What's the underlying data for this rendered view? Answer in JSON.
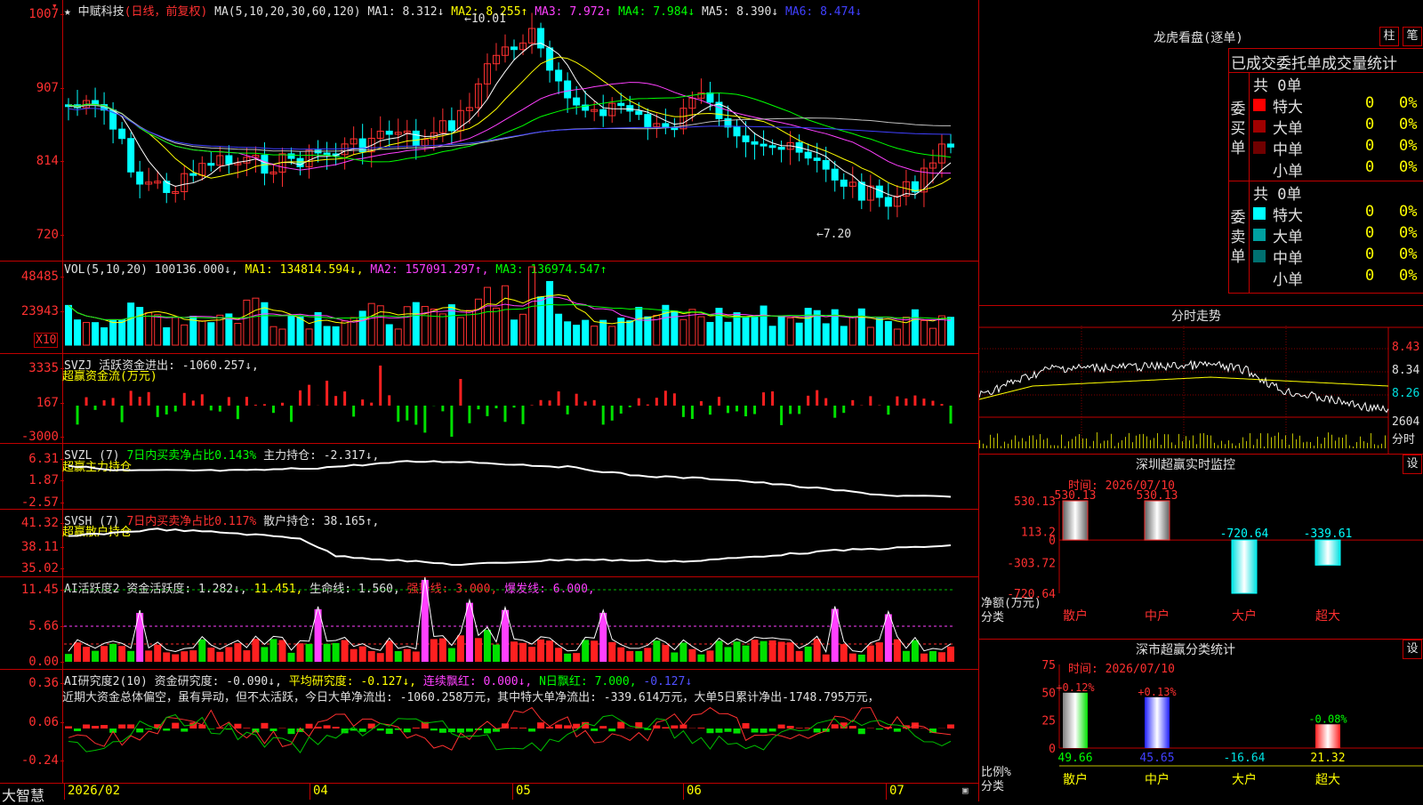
{
  "stock": {
    "star": "★",
    "name": "中赋科技",
    "mode": "(日线，前复权)"
  },
  "main_header": [
    {
      "label": "MA(5,10,20,30,60,120)",
      "color": "w"
    },
    {
      "label": "MA1: 8.312↓",
      "color": "w"
    },
    {
      "label": "MA2: 8.255↑",
      "color": "y"
    },
    {
      "label": "MA3: 7.972↑",
      "color": "m"
    },
    {
      "label": "MA4: 7.984↓",
      "color": "g"
    },
    {
      "label": "MA5: 8.390↓",
      "color": "w"
    },
    {
      "label": "MA6: 8.474↓",
      "color": "b"
    }
  ],
  "main_axis": [
    "1007",
    "907",
    "814",
    "720"
  ],
  "main_marks": {
    "high": "10.01",
    "low": "7.20",
    "high_arrow": "←",
    "low_arrow": "←"
  },
  "vol": {
    "header": [
      {
        "label": "VOL(5,10,20)",
        "color": "w"
      },
      {
        "label": "100136.000↓,",
        "color": "w"
      },
      {
        "label": "MA1: 134814.594↓,",
        "color": "y"
      },
      {
        "label": "MA2: 157091.297↑,",
        "color": "m"
      },
      {
        "label": "MA3: 136974.547↑",
        "color": "g"
      }
    ],
    "axis": [
      "48485",
      "23943"
    ],
    "unit": "X10"
  },
  "svzj": {
    "header": [
      {
        "label": "SVZJ",
        "color": "w"
      },
      {
        "label": "活跃资金进出: -1060.257↓,",
        "color": "w"
      }
    ],
    "sub": "超赢资金流(万元)",
    "axis": [
      "3335",
      "167",
      "-3000"
    ]
  },
  "svzl": {
    "header": [
      {
        "label": "SVZL (7)",
        "color": "w"
      },
      {
        "label": "7日内买卖净占比0.143%",
        "color": "g"
      },
      {
        "label": "主力持仓: -2.317↓,",
        "color": "w"
      }
    ],
    "sub": "超赢主力持仓",
    "axis": [
      "6.31",
      "1.87",
      "-2.57"
    ]
  },
  "svsh": {
    "header": [
      {
        "label": "SVSH (7)",
        "color": "w"
      },
      {
        "label": "7日内买卖净占比0.117%",
        "color": "r"
      },
      {
        "label": "散户持仓: 38.165↑,",
        "color": "w"
      }
    ],
    "sub": "超赢散户持仓",
    "axis": [
      "41.32",
      "38.11",
      "35.02"
    ]
  },
  "ai_act": {
    "header": [
      {
        "label": "AI活跃度2",
        "color": "w"
      },
      {
        "label": "资金活跃度: 1.282↓,",
        "color": "w"
      },
      {
        "label": "11.451,",
        "color": "y"
      },
      {
        "label": "生命线: 1.560,",
        "color": "w"
      },
      {
        "label": "强势线: 3.000,",
        "color": "r"
      },
      {
        "label": "爆发线: 6.000,",
        "color": "m"
      }
    ],
    "axis": [
      "11.45",
      "5.66",
      "0.00"
    ]
  },
  "ai_res": {
    "header": [
      {
        "label": "AI研究度2(10)",
        "color": "w"
      },
      {
        "label": "资金研究度: -0.090↓,",
        "color": "w"
      },
      {
        "label": "平均研究度: -0.127↓,",
        "color": "y"
      },
      {
        "label": "连续飘红: 0.000↓,",
        "color": "m"
      },
      {
        "label": "N日飘红: 7.000,",
        "color": "g"
      },
      {
        "label": "-0.127↓",
        "color": "bl"
      }
    ],
    "text": "近期大资金总体偏空，虽有异动，但不太活跃，今日大单净流出: -1060.258万元，其中特大单净流出: -339.614万元，大单5日累计净出-1748.795万元，",
    "axis": [
      "0.36",
      "0.06",
      "-0.24"
    ]
  },
  "dates": {
    "brand": "大智慧",
    "labels": [
      "2026/02",
      "04",
      "05",
      "06",
      "07"
    ]
  },
  "lhb": {
    "title": "龙虎看盘(逐单)",
    "btn_bar": "柱",
    "btn_pen": "笔",
    "subtitle": "已成交委托单成交量统计",
    "buy": {
      "label": "委买单",
      "total": "共 0单",
      "rows": [
        {
          "name": "特大",
          "count": "0",
          "pct": "0%",
          "color": "#ff0000"
        },
        {
          "name": "大单",
          "count": "0",
          "pct": "0%",
          "color": "#a00000"
        },
        {
          "name": "中单",
          "count": "0",
          "pct": "0%",
          "color": "#700000"
        },
        {
          "name": "小单",
          "count": "0",
          "pct": "0%",
          "color": "#000000"
        }
      ]
    },
    "sell": {
      "label": "委卖单",
      "total": "共 0单",
      "rows": [
        {
          "name": "特大",
          "count": "0",
          "pct": "0%",
          "color": "#00ffff"
        },
        {
          "name": "大单",
          "count": "0",
          "pct": "0%",
          "color": "#00a0a0"
        },
        {
          "name": "中单",
          "count": "0",
          "pct": "0%",
          "color": "#007070"
        },
        {
          "name": "小单",
          "count": "0",
          "pct": "0%",
          "color": "#000000"
        }
      ]
    }
  },
  "intraday": {
    "title": "分时走势",
    "axis": [
      "8.43",
      "8.34",
      "8.26",
      "2604"
    ],
    "unit": "分时"
  },
  "sz_monitor": {
    "title": "深圳超赢实时监控",
    "btn": "设",
    "time": "时间: 2026/07/10",
    "axis": [
      "530.13",
      "113.2",
      "0",
      "-303.72",
      "-720.64"
    ],
    "ylabel": "净额(万元)",
    "xlabel": "分类",
    "chart_data": {
      "type": "bar",
      "categories": [
        "散户",
        "中户",
        "大户",
        "超大"
      ],
      "values": [
        530.13,
        530.13,
        -720.64,
        -339.61
      ],
      "value_labels": [
        "530.13",
        "530.13",
        "-720.64",
        "-339.61"
      ],
      "ylim": [
        -720.64,
        530.13
      ]
    }
  },
  "sz_stat": {
    "title": "深市超赢分类统计",
    "btn": "设",
    "time": "时间: 2026/07/10",
    "axis": [
      "75",
      "50",
      "25",
      "0"
    ],
    "ylabel": "比例%",
    "xlabel": "分类",
    "chart_data": {
      "type": "bar",
      "categories": [
        "散户",
        "中户",
        "大户",
        "超大"
      ],
      "values": [
        49.66,
        45.65,
        -16.64,
        21.32
      ],
      "value_labels": [
        "49.66",
        "45.65",
        "-16.64",
        "21.32"
      ],
      "change_labels": [
        "+0.12%",
        "+0.13%",
        "",
        "-0.08%"
      ],
      "ylim": [
        0,
        75
      ]
    }
  }
}
